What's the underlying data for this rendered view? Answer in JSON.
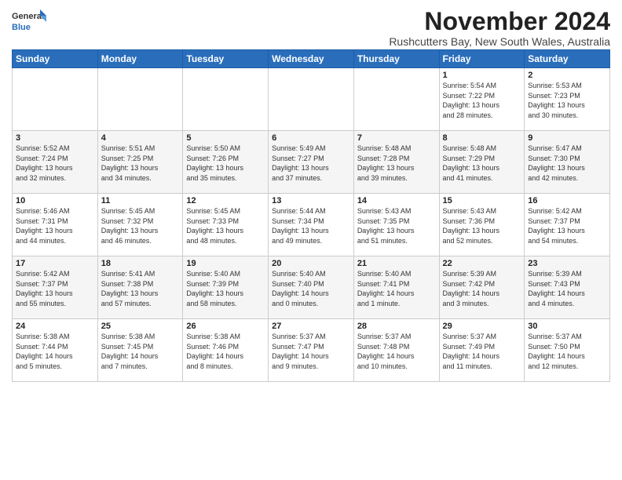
{
  "logo": {
    "general": "General",
    "blue": "Blue"
  },
  "header": {
    "month_title": "November 2024",
    "subtitle": "Rushcutters Bay, New South Wales, Australia"
  },
  "weekdays": [
    "Sunday",
    "Monday",
    "Tuesday",
    "Wednesday",
    "Thursday",
    "Friday",
    "Saturday"
  ],
  "weeks": [
    [
      {
        "day": "",
        "info": ""
      },
      {
        "day": "",
        "info": ""
      },
      {
        "day": "",
        "info": ""
      },
      {
        "day": "",
        "info": ""
      },
      {
        "day": "",
        "info": ""
      },
      {
        "day": "1",
        "info": "Sunrise: 5:54 AM\nSunset: 7:22 PM\nDaylight: 13 hours\nand 28 minutes."
      },
      {
        "day": "2",
        "info": "Sunrise: 5:53 AM\nSunset: 7:23 PM\nDaylight: 13 hours\nand 30 minutes."
      }
    ],
    [
      {
        "day": "3",
        "info": "Sunrise: 5:52 AM\nSunset: 7:24 PM\nDaylight: 13 hours\nand 32 minutes."
      },
      {
        "day": "4",
        "info": "Sunrise: 5:51 AM\nSunset: 7:25 PM\nDaylight: 13 hours\nand 34 minutes."
      },
      {
        "day": "5",
        "info": "Sunrise: 5:50 AM\nSunset: 7:26 PM\nDaylight: 13 hours\nand 35 minutes."
      },
      {
        "day": "6",
        "info": "Sunrise: 5:49 AM\nSunset: 7:27 PM\nDaylight: 13 hours\nand 37 minutes."
      },
      {
        "day": "7",
        "info": "Sunrise: 5:48 AM\nSunset: 7:28 PM\nDaylight: 13 hours\nand 39 minutes."
      },
      {
        "day": "8",
        "info": "Sunrise: 5:48 AM\nSunset: 7:29 PM\nDaylight: 13 hours\nand 41 minutes."
      },
      {
        "day": "9",
        "info": "Sunrise: 5:47 AM\nSunset: 7:30 PM\nDaylight: 13 hours\nand 42 minutes."
      }
    ],
    [
      {
        "day": "10",
        "info": "Sunrise: 5:46 AM\nSunset: 7:31 PM\nDaylight: 13 hours\nand 44 minutes."
      },
      {
        "day": "11",
        "info": "Sunrise: 5:45 AM\nSunset: 7:32 PM\nDaylight: 13 hours\nand 46 minutes."
      },
      {
        "day": "12",
        "info": "Sunrise: 5:45 AM\nSunset: 7:33 PM\nDaylight: 13 hours\nand 48 minutes."
      },
      {
        "day": "13",
        "info": "Sunrise: 5:44 AM\nSunset: 7:34 PM\nDaylight: 13 hours\nand 49 minutes."
      },
      {
        "day": "14",
        "info": "Sunrise: 5:43 AM\nSunset: 7:35 PM\nDaylight: 13 hours\nand 51 minutes."
      },
      {
        "day": "15",
        "info": "Sunrise: 5:43 AM\nSunset: 7:36 PM\nDaylight: 13 hours\nand 52 minutes."
      },
      {
        "day": "16",
        "info": "Sunrise: 5:42 AM\nSunset: 7:37 PM\nDaylight: 13 hours\nand 54 minutes."
      }
    ],
    [
      {
        "day": "17",
        "info": "Sunrise: 5:42 AM\nSunset: 7:37 PM\nDaylight: 13 hours\nand 55 minutes."
      },
      {
        "day": "18",
        "info": "Sunrise: 5:41 AM\nSunset: 7:38 PM\nDaylight: 13 hours\nand 57 minutes."
      },
      {
        "day": "19",
        "info": "Sunrise: 5:40 AM\nSunset: 7:39 PM\nDaylight: 13 hours\nand 58 minutes."
      },
      {
        "day": "20",
        "info": "Sunrise: 5:40 AM\nSunset: 7:40 PM\nDaylight: 14 hours\nand 0 minutes."
      },
      {
        "day": "21",
        "info": "Sunrise: 5:40 AM\nSunset: 7:41 PM\nDaylight: 14 hours\nand 1 minute."
      },
      {
        "day": "22",
        "info": "Sunrise: 5:39 AM\nSunset: 7:42 PM\nDaylight: 14 hours\nand 3 minutes."
      },
      {
        "day": "23",
        "info": "Sunrise: 5:39 AM\nSunset: 7:43 PM\nDaylight: 14 hours\nand 4 minutes."
      }
    ],
    [
      {
        "day": "24",
        "info": "Sunrise: 5:38 AM\nSunset: 7:44 PM\nDaylight: 14 hours\nand 5 minutes."
      },
      {
        "day": "25",
        "info": "Sunrise: 5:38 AM\nSunset: 7:45 PM\nDaylight: 14 hours\nand 7 minutes."
      },
      {
        "day": "26",
        "info": "Sunrise: 5:38 AM\nSunset: 7:46 PM\nDaylight: 14 hours\nand 8 minutes."
      },
      {
        "day": "27",
        "info": "Sunrise: 5:37 AM\nSunset: 7:47 PM\nDaylight: 14 hours\nand 9 minutes."
      },
      {
        "day": "28",
        "info": "Sunrise: 5:37 AM\nSunset: 7:48 PM\nDaylight: 14 hours\nand 10 minutes."
      },
      {
        "day": "29",
        "info": "Sunrise: 5:37 AM\nSunset: 7:49 PM\nDaylight: 14 hours\nand 11 minutes."
      },
      {
        "day": "30",
        "info": "Sunrise: 5:37 AM\nSunset: 7:50 PM\nDaylight: 14 hours\nand 12 minutes."
      }
    ]
  ]
}
